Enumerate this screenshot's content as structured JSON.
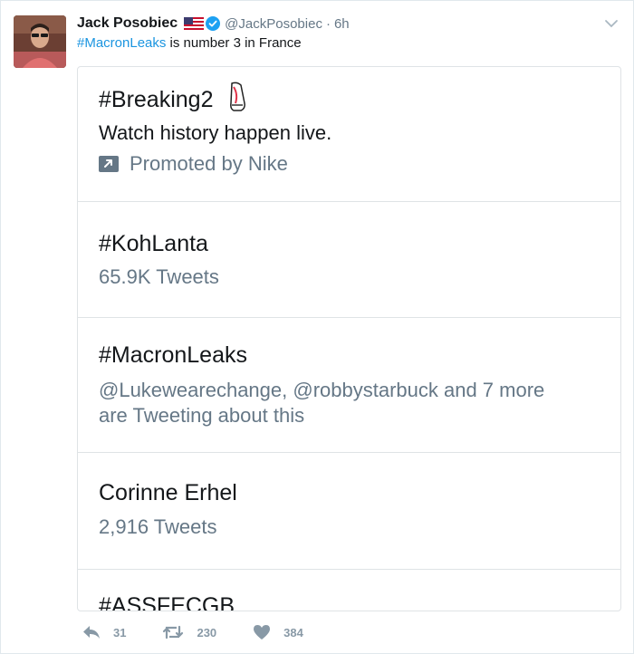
{
  "tweet": {
    "author_name": "Jack Posobiec",
    "flag_icon": "us-flag-icon",
    "verified_icon": "verified-badge-icon",
    "handle": "@JackPosobiec",
    "separator": "·",
    "time": "6h",
    "text_hashtag": "#MacronLeaks",
    "text_rest": " is number 3 in France"
  },
  "trends": [
    {
      "title": "#Breaking2",
      "body": "Watch history happen live.",
      "promo_label": "Promoted by Nike"
    },
    {
      "title": "#KohLanta",
      "subtitle": "65.9K Tweets"
    },
    {
      "title": "#MacronLeaks",
      "subtitle_line1": "@Lukewearechange, @robbystarbuck and 7 more",
      "subtitle_line2": "are Tweeting about this"
    },
    {
      "title": "Corinne Erhel",
      "subtitle": "2,916 Tweets"
    },
    {
      "title": "#ASSFECGB"
    }
  ],
  "actions": {
    "reply_count": "31",
    "retweet_count": "230",
    "like_count": "384"
  },
  "colors": {
    "link_blue": "#1b95e0",
    "verified_blue": "#1da1f2",
    "muted_gray": "#657786",
    "action_gray": "#8899a6"
  }
}
